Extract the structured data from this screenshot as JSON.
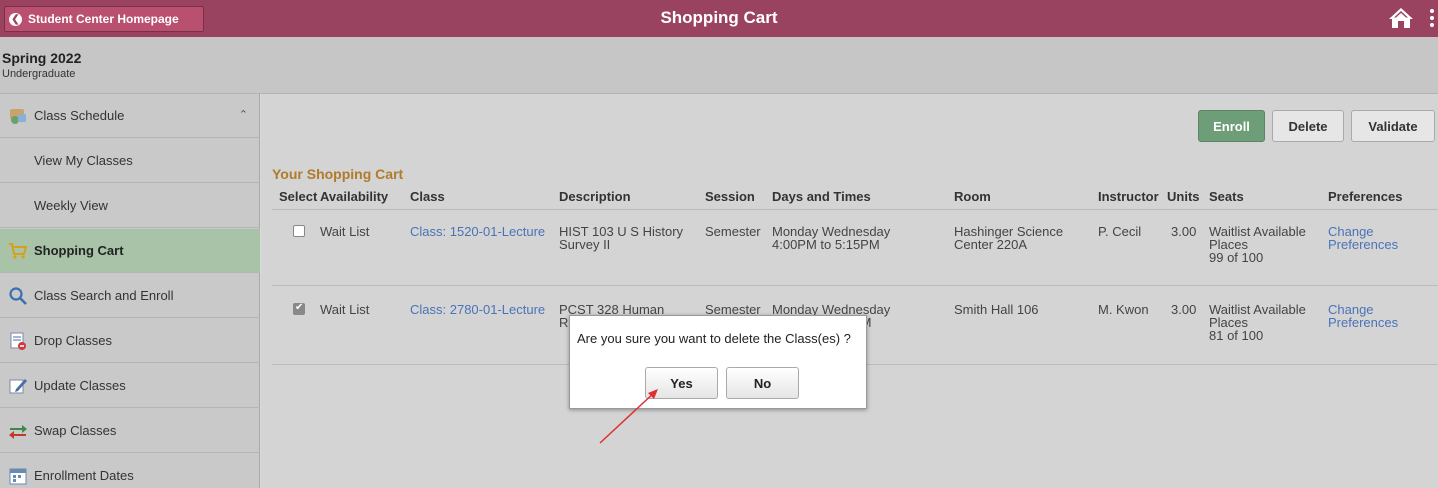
{
  "header": {
    "back_label": "Student Center Homepage",
    "title": "Shopping Cart"
  },
  "term": {
    "name": "Spring 2022",
    "career": "Undergraduate"
  },
  "sidebar": {
    "items": [
      {
        "label": "Class Schedule"
      },
      {
        "label": "View My Classes"
      },
      {
        "label": "Weekly View"
      },
      {
        "label": "Shopping Cart"
      },
      {
        "label": "Class Search and Enroll"
      },
      {
        "label": "Drop Classes"
      },
      {
        "label": "Update Classes"
      },
      {
        "label": "Swap Classes"
      },
      {
        "label": "Enrollment Dates"
      }
    ]
  },
  "toolbar": {
    "enroll": "Enroll",
    "delete": "Delete",
    "validate": "Validate"
  },
  "cart": {
    "heading": "Your Shopping Cart",
    "columns": [
      "Select",
      "Availability",
      "Class",
      "Description",
      "Session",
      "Days and Times",
      "Room",
      "Instructor",
      "Units",
      "Seats",
      "Preferences"
    ],
    "rows": [
      {
        "selected": false,
        "availability": "Wait List",
        "class": "Class: 1520-01-Lecture",
        "desc1": "HIST 103 U S History",
        "desc2": "Survey II",
        "session": "Semester",
        "days": "Monday Wednesday",
        "times": "4:00PM to 5:15PM",
        "room1": "Hashinger Science",
        "room2": "Center 220A",
        "instructor": "P. Cecil",
        "units": "3.00",
        "seats1": "Waitlist Available",
        "seats2": "Places",
        "seats3": "99 of 100",
        "pref1": "Change",
        "pref2": "Preferences"
      },
      {
        "selected": true,
        "availability": "Wait List",
        "class": "Class: 2780-01-Lecture",
        "desc1": "PCST 328 Human",
        "desc2": "R",
        "session": "Semester",
        "days": "Monday Wednesday",
        "times": "PM",
        "room1": "Smith Hall 106",
        "instructor": "M. Kwon",
        "units": "3.00",
        "seats1": "Waitlist Available",
        "seats2": "Places",
        "seats3": "81 of 100",
        "pref1": "Change",
        "pref2": "Preferences"
      }
    ]
  },
  "dialog": {
    "message": "Are you sure you want to delete the Class(es) ?",
    "yes": "Yes",
    "no": "No"
  },
  "icons": {
    "back": "chevron-left-icon",
    "home": "home-icon",
    "more": "more-vertical-icon"
  },
  "colors": {
    "header": "#9a4361",
    "active_nav": "#a9c3a9",
    "enroll_button": "#6e9e78",
    "heading": "#b07b2a",
    "link": "#4a73b8",
    "annotation_arrow": "#e03030"
  }
}
